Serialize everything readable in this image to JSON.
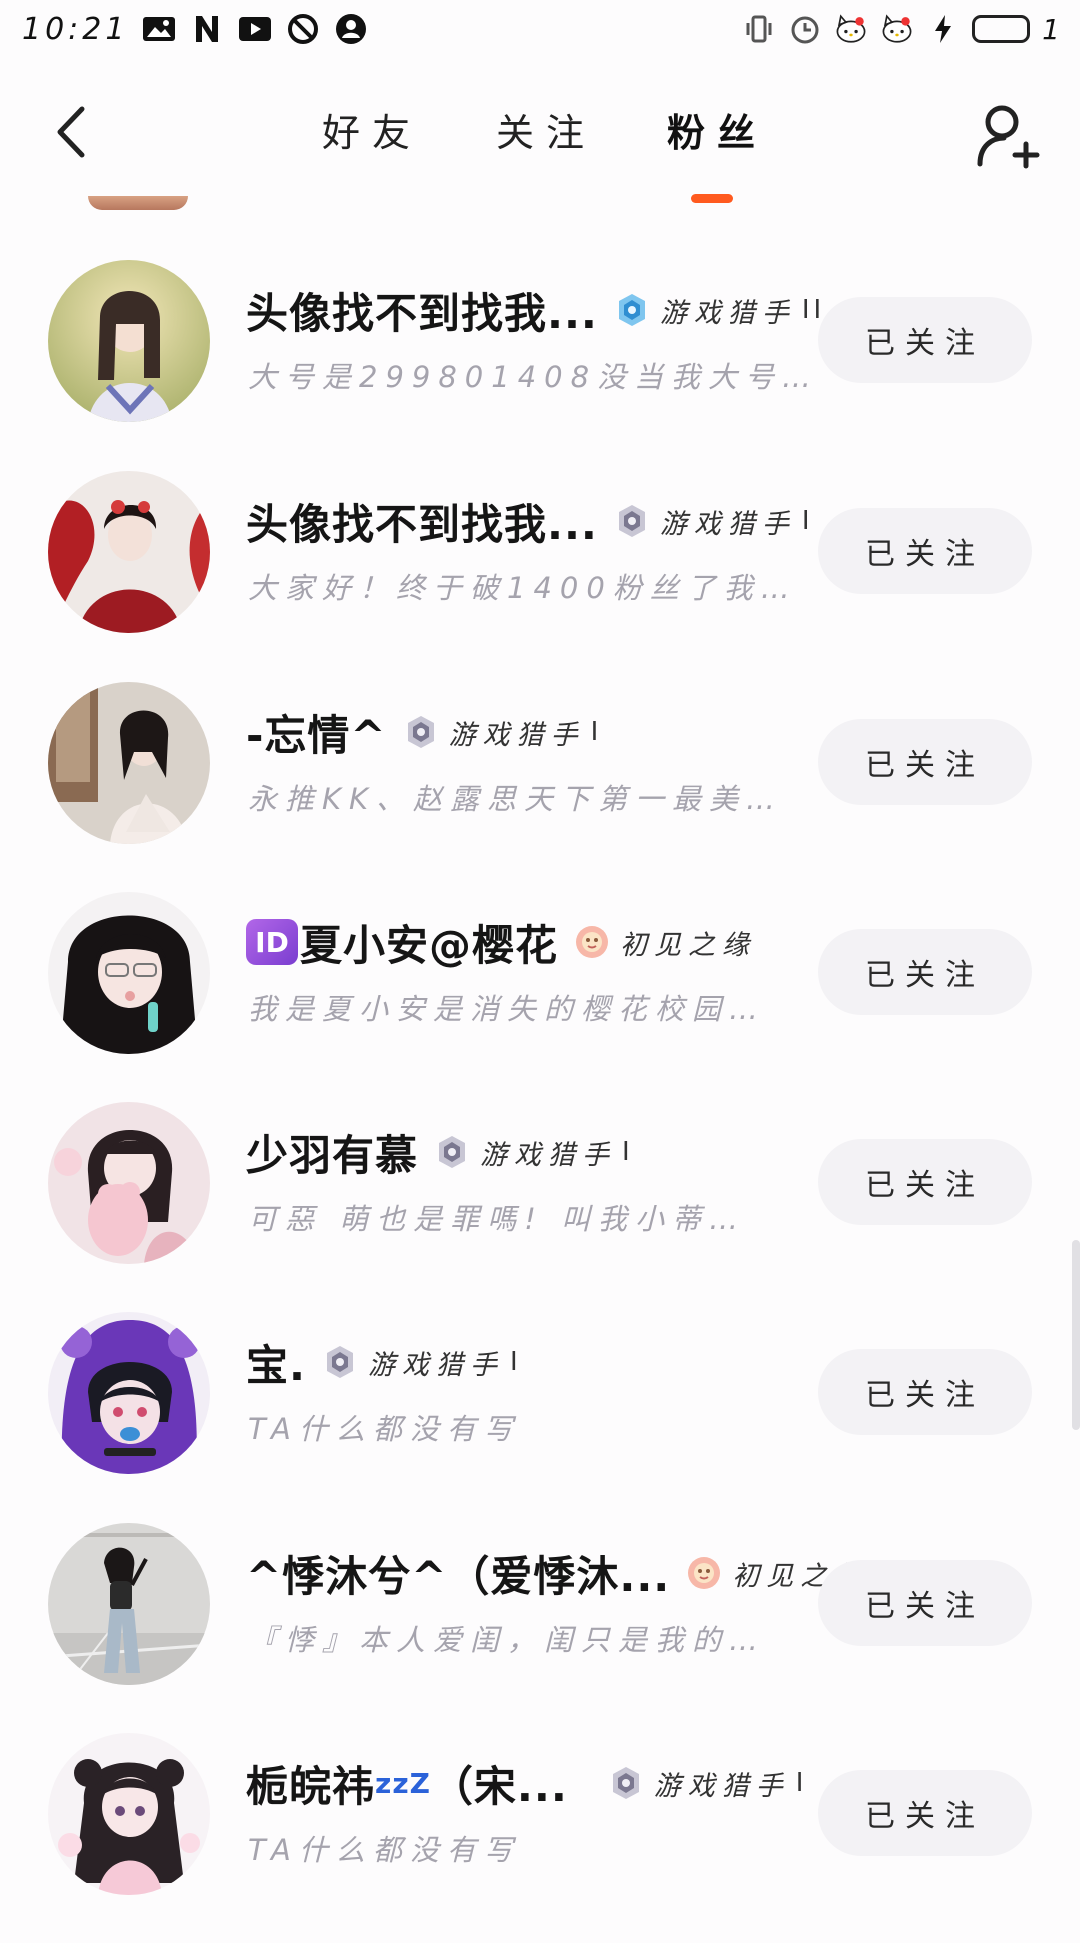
{
  "status_bar": {
    "time": "10:21",
    "battery_level": "1",
    "icons_left": [
      "image-icon",
      "n-icon",
      "play-icon",
      "blocked-icon",
      "account-icon"
    ],
    "icons_right": [
      "vibrate-icon",
      "alarm-icon",
      "cat-icon",
      "cat-icon",
      "charging-icon"
    ]
  },
  "header": {
    "tabs": [
      {
        "label": "好友",
        "active": false
      },
      {
        "label": "关注",
        "active": false
      },
      {
        "label": "粉丝",
        "active": true
      }
    ],
    "accent_color": "#ff5a1f"
  },
  "followers": [
    {
      "name": "头像找不到找我...",
      "badge": "游戏猎手",
      "badge_color": "blue",
      "level": "II",
      "signature": "大号是299801408没当我大号…",
      "button": "已关注",
      "prefix_id": false,
      "zz": ""
    },
    {
      "name": "头像找不到找我...",
      "badge": "游戏猎手",
      "badge_color": "grey",
      "level": "I",
      "signature": "大家好！终于破1400粉丝了我…",
      "button": "已关注",
      "prefix_id": false,
      "zz": ""
    },
    {
      "name": "-忘情^",
      "badge": "游戏猎手",
      "badge_color": "grey",
      "level": "I",
      "signature": "永推KK、赵露思天下第一最美…",
      "button": "已关注",
      "prefix_id": false,
      "zz": ""
    },
    {
      "name": "夏小安@樱花",
      "badge": "初见之缘",
      "badge_color": "pink",
      "level": "",
      "signature": "我是夏小安是消失的樱花校园…",
      "button": "已关注",
      "prefix_id": true,
      "id_label": "ID",
      "zz": ""
    },
    {
      "name": "少羽有慕",
      "badge": "游戏猎手",
      "badge_color": "grey",
      "level": "I",
      "signature": "可惡 萌也是罪嗎! 叫我小蒂…",
      "button": "已关注",
      "prefix_id": false,
      "zz": ""
    },
    {
      "name": "宝.",
      "badge": "游戏猎手",
      "badge_color": "grey",
      "level": "I",
      "signature": "TA什么都没有写",
      "button": "已关注",
      "prefix_id": false,
      "zz": ""
    },
    {
      "name": "^悸沐兮^（爱悸沐...",
      "badge": "初见之缘",
      "badge_color": "pink",
      "level": "",
      "signature": "『悸』本人爱闺，闺只是我的…",
      "button": "已关注",
      "prefix_id": false,
      "zz": ""
    },
    {
      "name": "栀皖祎",
      "zz": "zzZ",
      "name_tail": "（宋...",
      "badge": "游戏猎手",
      "badge_color": "grey",
      "level": "I",
      "signature": "TA什么都没有写",
      "button": "已关注",
      "prefix_id": false
    }
  ]
}
